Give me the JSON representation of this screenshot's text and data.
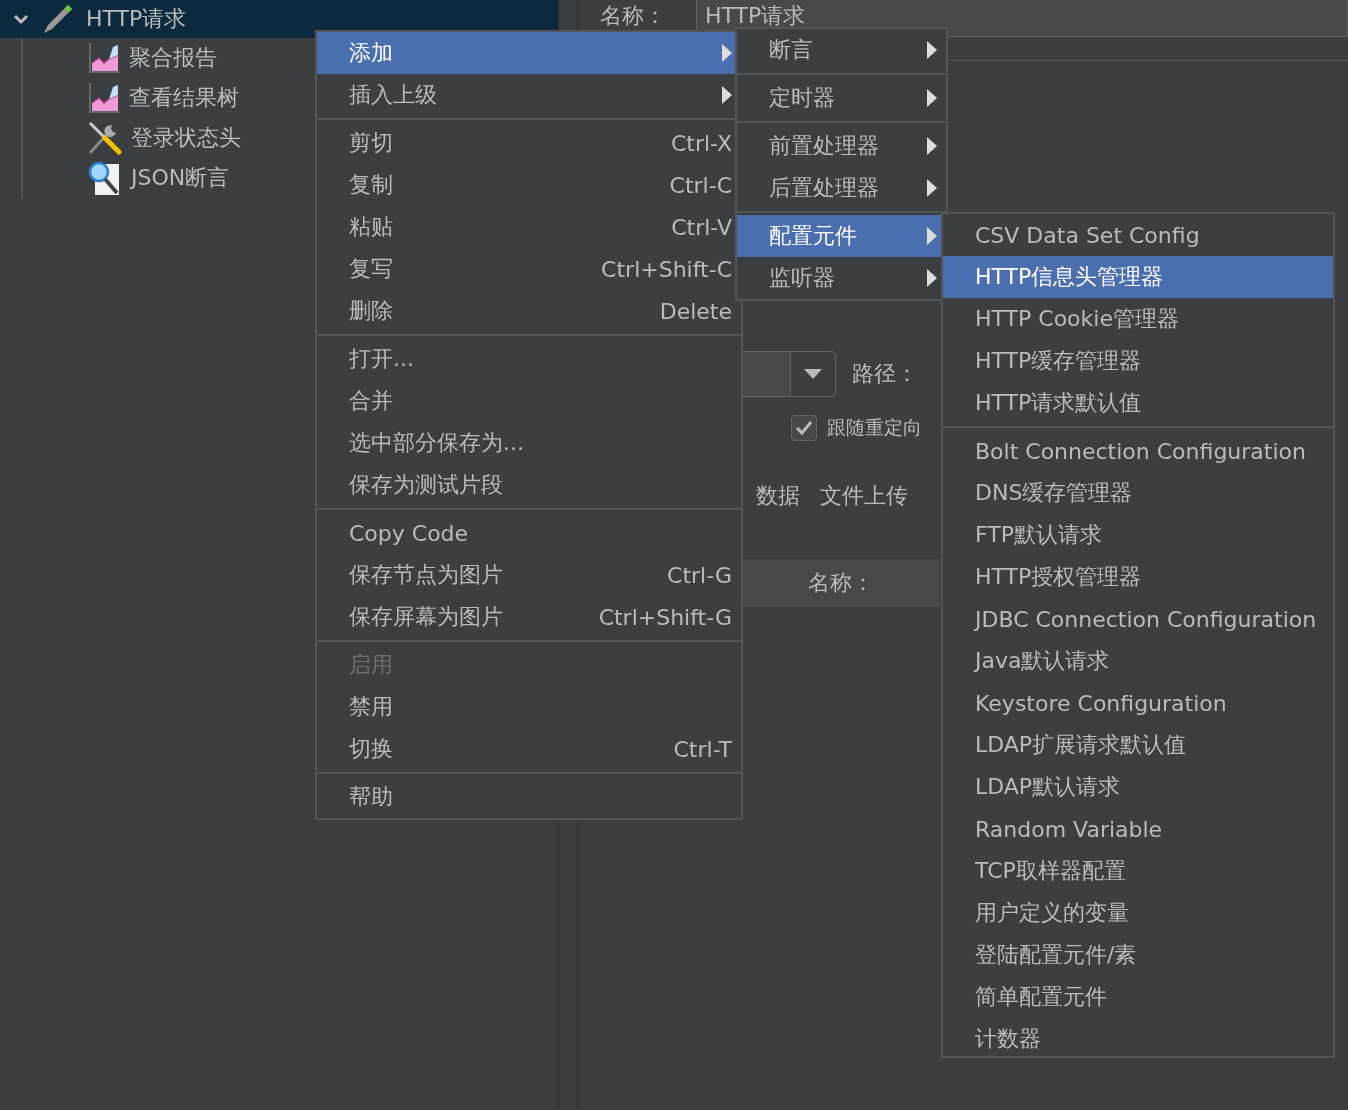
{
  "tree": {
    "label": "HTTP请求",
    "expanded": true,
    "selected": true,
    "children": [
      {
        "label": "聚合报告",
        "kind": "report"
      },
      {
        "label": "查看结果树",
        "kind": "report"
      },
      {
        "label": "登录状态头",
        "kind": "tools"
      },
      {
        "label": "JSON断言",
        "kind": "magnifier"
      }
    ]
  },
  "form": {
    "name_label": "名称：",
    "name_value": "HTTP请求",
    "path_label": "路径：",
    "checkbox": {
      "label": "跟随重定向",
      "checked": true
    },
    "tabs": [
      {
        "label": "数据",
        "selected": false
      },
      {
        "label": "文件上传",
        "selected": false
      }
    ],
    "table_header": "名称："
  },
  "context_menu": {
    "groups": [
      [
        {
          "label": "添加",
          "submenu": true,
          "selected": true,
          "disabled": false
        },
        {
          "label": "插入上级",
          "submenu": true,
          "selected": false,
          "disabled": false
        }
      ],
      [
        {
          "label": "剪切",
          "shortcut": "Ctrl-X",
          "selected": false,
          "disabled": false
        },
        {
          "label": "复制",
          "shortcut": "Ctrl-C",
          "selected": false,
          "disabled": false
        },
        {
          "label": "粘贴",
          "shortcut": "Ctrl-V",
          "selected": false,
          "disabled": false
        },
        {
          "label": "复写",
          "shortcut": "Ctrl+Shift-C",
          "selected": false,
          "disabled": false
        },
        {
          "label": "删除",
          "shortcut": "Delete",
          "selected": false,
          "disabled": false
        }
      ],
      [
        {
          "label": "打开...",
          "selected": false,
          "disabled": false
        },
        {
          "label": "合并",
          "selected": false,
          "disabled": false
        },
        {
          "label": "选中部分保存为...",
          "selected": false,
          "disabled": false
        },
        {
          "label": "保存为测试片段",
          "selected": false,
          "disabled": false
        }
      ],
      [
        {
          "label": "Copy Code",
          "selected": false,
          "disabled": false
        },
        {
          "label": "保存节点为图片",
          "shortcut": "Ctrl-G",
          "selected": false,
          "disabled": false
        },
        {
          "label": "保存屏幕为图片",
          "shortcut": "Ctrl+Shift-G",
          "selected": false,
          "disabled": false
        }
      ],
      [
        {
          "label": "启用",
          "selected": false,
          "disabled": true
        },
        {
          "label": "禁用",
          "selected": false,
          "disabled": false
        },
        {
          "label": "切换",
          "shortcut": "Ctrl-T",
          "selected": false,
          "disabled": false
        }
      ],
      [
        {
          "label": "帮助",
          "selected": false,
          "disabled": false
        }
      ]
    ]
  },
  "add_submenu": {
    "groups": [
      [
        {
          "label": "断言",
          "submenu": true,
          "selected": false,
          "disabled": false
        }
      ],
      [
        {
          "label": "定时器",
          "submenu": true,
          "selected": false,
          "disabled": false
        }
      ],
      [
        {
          "label": "前置处理器",
          "submenu": true,
          "selected": false,
          "disabled": false
        },
        {
          "label": "后置处理器",
          "submenu": true,
          "selected": false,
          "disabled": false
        }
      ],
      [
        {
          "label": "配置元件",
          "submenu": true,
          "selected": true,
          "disabled": false
        },
        {
          "label": "监听器",
          "submenu": true,
          "selected": false,
          "disabled": false
        }
      ]
    ]
  },
  "config_submenu": {
    "groups": [
      [
        {
          "label": "CSV Data Set Config",
          "selected": false,
          "disabled": false
        },
        {
          "label": "HTTP信息头管理器",
          "selected": true,
          "disabled": false
        },
        {
          "label": "HTTP Cookie管理器",
          "selected": false,
          "disabled": false
        },
        {
          "label": "HTTP缓存管理器",
          "selected": false,
          "disabled": false
        },
        {
          "label": "HTTP请求默认值",
          "selected": false,
          "disabled": false
        }
      ],
      [
        {
          "label": "Bolt Connection Configuration",
          "selected": false,
          "disabled": false
        },
        {
          "label": "DNS缓存管理器",
          "selected": false,
          "disabled": false
        },
        {
          "label": "FTP默认请求",
          "selected": false,
          "disabled": false
        },
        {
          "label": "HTTP授权管理器",
          "selected": false,
          "disabled": false
        },
        {
          "label": "JDBC Connection Configuration",
          "selected": false,
          "disabled": false
        },
        {
          "label": "Java默认请求",
          "selected": false,
          "disabled": false
        },
        {
          "label": "Keystore Configuration",
          "selected": false,
          "disabled": false
        },
        {
          "label": "LDAP扩展请求默认值",
          "selected": false,
          "disabled": false
        },
        {
          "label": "LDAP默认请求",
          "selected": false,
          "disabled": false
        },
        {
          "label": "Random Variable",
          "selected": false,
          "disabled": false
        },
        {
          "label": "TCP取样器配置",
          "selected": false,
          "disabled": false
        },
        {
          "label": "用户定义的变量",
          "selected": false,
          "disabled": false
        },
        {
          "label": "登陆配置元件/素",
          "selected": false,
          "disabled": false
        },
        {
          "label": "简单配置元件",
          "selected": false,
          "disabled": false
        },
        {
          "label": "计数器",
          "selected": false,
          "disabled": false
        }
      ]
    ]
  }
}
